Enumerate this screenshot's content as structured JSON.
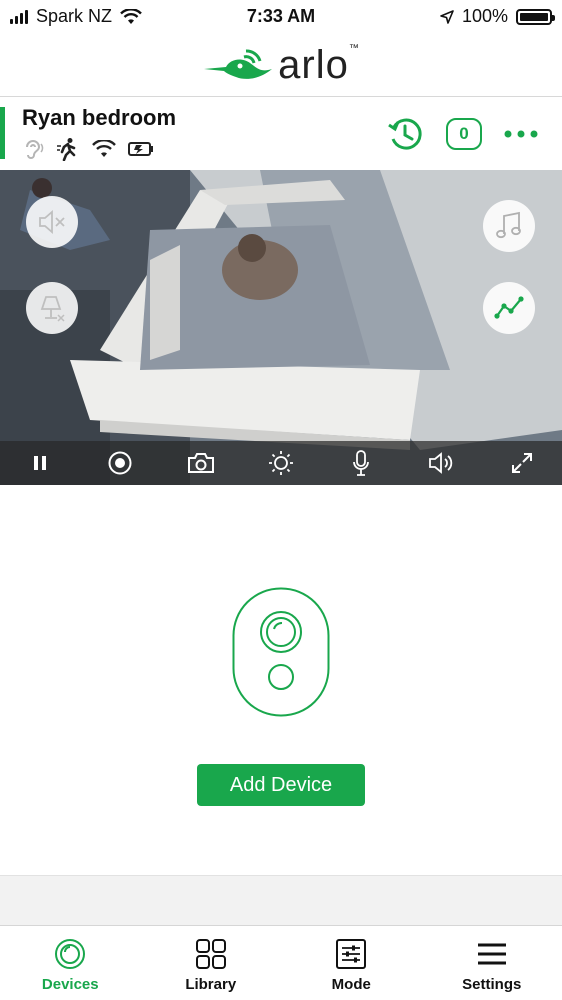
{
  "status_bar": {
    "carrier": "Spark NZ",
    "time": "7:33 AM",
    "battery_percent": "100%",
    "battery_level": 1.0
  },
  "logo": {
    "text": "arlo",
    "trademark": "™"
  },
  "camera": {
    "name": "Ryan bedroom",
    "event_count": "0",
    "status_icons": [
      "ear-icon",
      "motion-icon",
      "wifi-icon",
      "battery-charging-icon"
    ],
    "overlay_buttons": [
      "mute-icon",
      "music-note-icon",
      "night-light-icon",
      "graph-icon"
    ],
    "toolbar_icons": [
      "pause-icon",
      "record-icon",
      "camera-snapshot-icon",
      "brightness-icon",
      "microphone-icon",
      "speaker-icon",
      "fullscreen-icon"
    ]
  },
  "empty_state": {
    "add_device_label": "Add Device"
  },
  "tabs": [
    {
      "label": "Devices",
      "icon": "devices-icon",
      "active": true
    },
    {
      "label": "Library",
      "icon": "library-icon",
      "active": false
    },
    {
      "label": "Mode",
      "icon": "mode-icon",
      "active": false
    },
    {
      "label": "Settings",
      "icon": "settings-icon",
      "active": false
    }
  ],
  "colors": {
    "accent": "#19a74c",
    "text": "#111111",
    "toolbar": "#282828"
  }
}
